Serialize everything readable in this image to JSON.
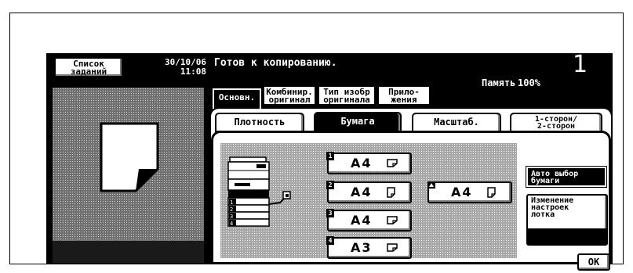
{
  "header": {
    "jobs_button": {
      "line1": "Список",
      "line2": "заданий"
    },
    "date": "30/10/06",
    "time": "11:08",
    "status_message": "Готов к копированию.",
    "memory_label": "Память",
    "memory_value": "100%",
    "copy_count": "1"
  },
  "top_tabs": [
    {
      "line1": "Основн.",
      "line2": "",
      "selected": true
    },
    {
      "line1": "Комбинир.",
      "line2": "оригинал",
      "selected": false
    },
    {
      "line1": "Тип изобр",
      "line2": "оригинала",
      "selected": false
    },
    {
      "line1": "Прило-",
      "line2": "жения",
      "selected": false
    }
  ],
  "sub_tabs": [
    {
      "line1": "Плотность",
      "line2": "",
      "selected": false
    },
    {
      "line1": "Бумага",
      "line2": "",
      "selected": true
    },
    {
      "line1": "Масштаб.",
      "line2": "",
      "selected": false
    },
    {
      "line1": "1-сторон/",
      "line2": "2-сторон",
      "selected": false
    }
  ],
  "trays": [
    {
      "number": "1",
      "size": "A4",
      "orientation": "landscape"
    },
    {
      "number": "2",
      "size": "A4",
      "orientation": "portrait"
    },
    {
      "number": "3",
      "size": "A4",
      "orientation": "landscape"
    },
    {
      "number": "4",
      "size": "A3",
      "orientation": "landscape"
    }
  ],
  "bypass_tray": {
    "size": "A4",
    "orientation": "portrait"
  },
  "copier_tray_labels": [
    "1",
    "2",
    "3",
    "4"
  ],
  "buttons": {
    "auto_paper": {
      "line1": "Авто выбор",
      "line2": "бумаги"
    },
    "tray_settings": {
      "line1": "Изменение",
      "line2": "настроек",
      "line3": "лотка"
    },
    "ok": "OK"
  },
  "colors": {
    "screen": "#000000",
    "panel": "#ffffff",
    "pattern_dark": "#6e6e6e",
    "pattern_light": "#a6a6a6"
  }
}
